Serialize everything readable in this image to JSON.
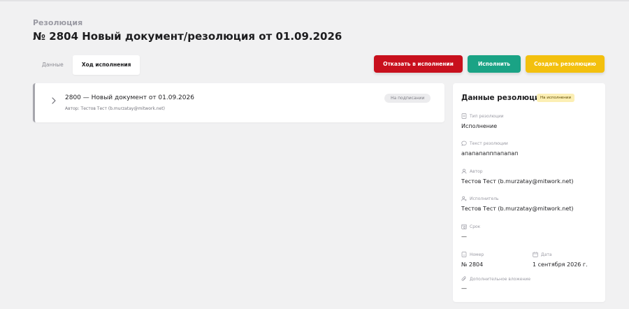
{
  "header": {
    "section_label": "Резолюция",
    "title": "№ 2804 Новый документ/резолюция от 01.09.2026"
  },
  "tabs": [
    {
      "label": "Данные",
      "active": false
    },
    {
      "label": "Ход исполнения",
      "active": true
    }
  ],
  "actions": {
    "reject_label": "Отказать в исполнении",
    "execute_label": "Исполнить",
    "create_label": "Создать резолюцию"
  },
  "colors": {
    "reject": "#c8101d",
    "execute": "#1aa385",
    "create": "#f3c00e",
    "status_badge_bg": "#fcefb4"
  },
  "document": {
    "title": "2800 — Новый документ от 01.09.2026",
    "author": "Автор: Тестов Тест (b.murzatay@mitwork.net)",
    "status": "На подписании",
    "expand_icon": "chevron-right-icon"
  },
  "resolution": {
    "title": "Данные резолюции",
    "status": "На исполнении",
    "fields": {
      "type": {
        "label": "Тип резолюции",
        "value": "Исполнение",
        "icon": "document-icon"
      },
      "text": {
        "label": "Текст резолюции",
        "value": "апапапапппапапап",
        "icon": "comment-icon"
      },
      "author": {
        "label": "Автор",
        "value": "Тестов Тест (b.murzatay@mitwork.net)",
        "icon": "user-icon"
      },
      "executor": {
        "label": "Исполнитель",
        "value": "Тестов Тест (b.murzatay@mitwork.net)",
        "icon": "user-add-icon"
      },
      "deadline": {
        "label": "Срок",
        "value": "—",
        "icon": "calendar-clock-icon"
      },
      "number": {
        "label": "Номер",
        "value": "№ 2804",
        "icon": "document-number-icon"
      },
      "date": {
        "label": "Дата",
        "value": "1 сентября 2026 г.",
        "icon": "calendar-icon"
      },
      "attachment": {
        "label": "Дополнительное вложение",
        "value": "—",
        "icon": "paperclip-icon"
      }
    }
  }
}
